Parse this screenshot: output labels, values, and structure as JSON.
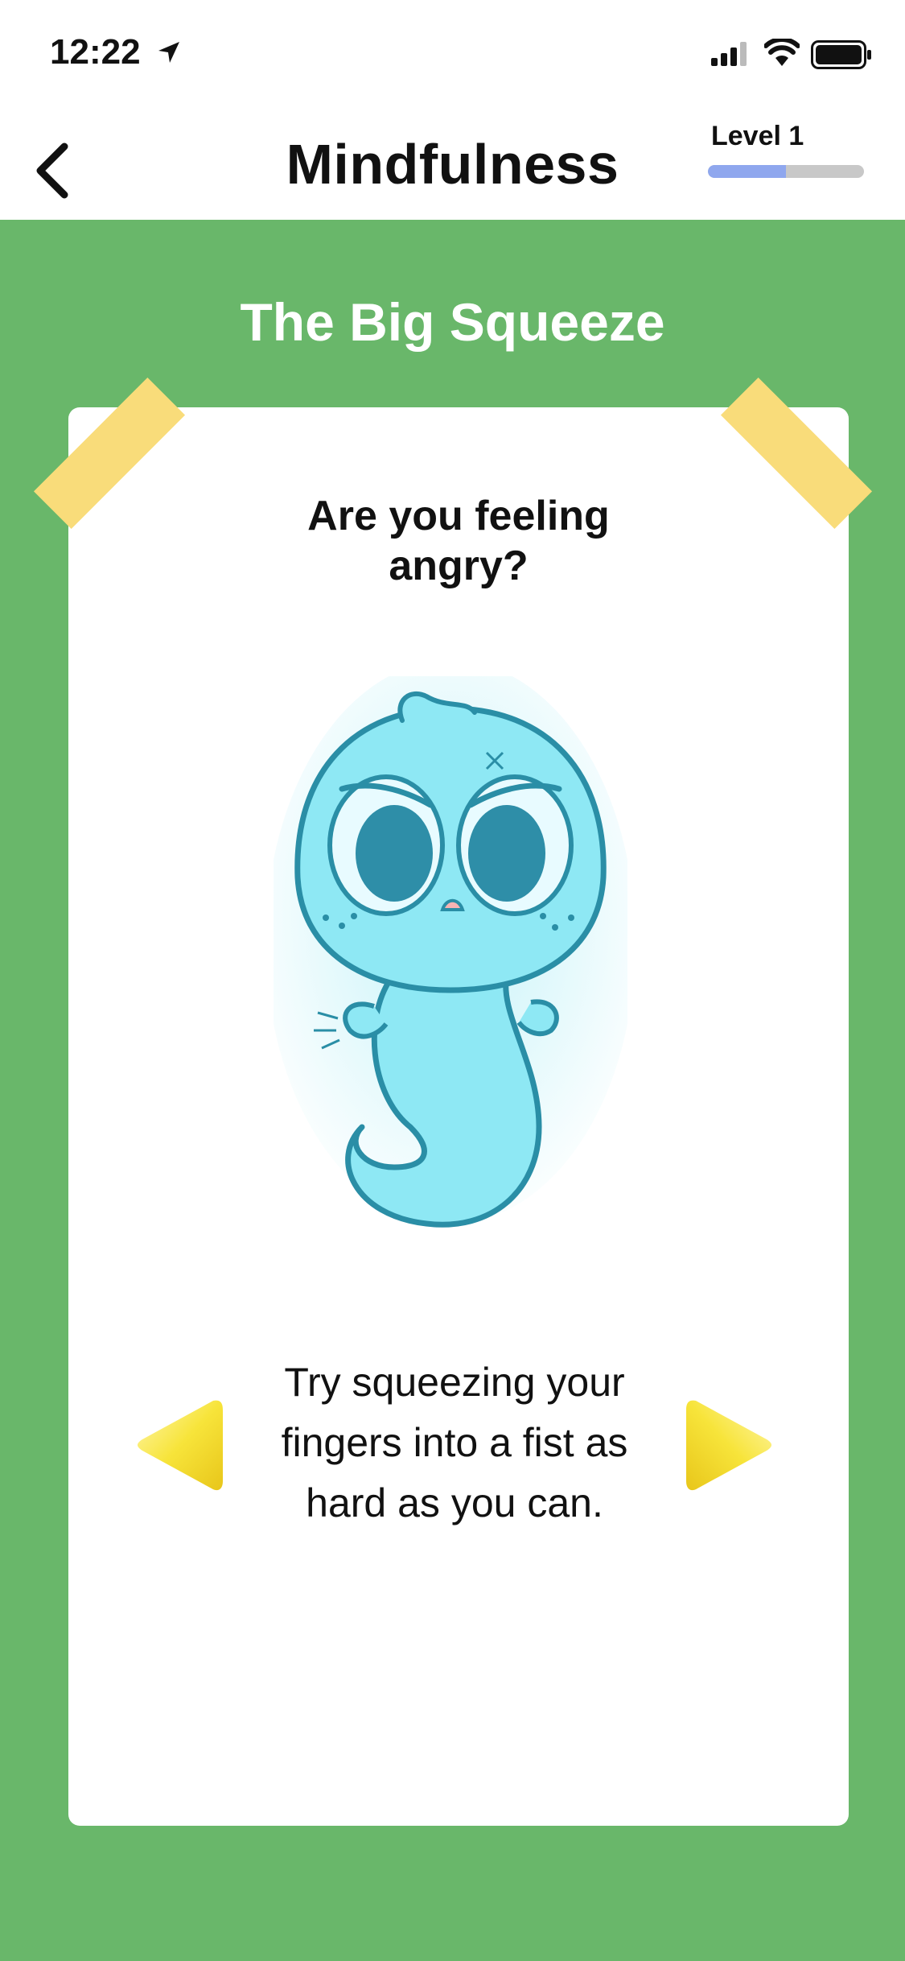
{
  "status_bar": {
    "time": "12:22",
    "icons": [
      "location-arrow-icon",
      "signal-icon",
      "wifi-icon",
      "battery-icon"
    ]
  },
  "nav": {
    "back_icon": "chevron-left-icon",
    "title": "Mindfulness",
    "level_label": "Level 1",
    "level_progress": 0.5
  },
  "activity": {
    "title": "The Big Squeeze",
    "question_lines": [
      "Are you feeling",
      "angry?"
    ],
    "instruction_lines": [
      "Try squeezing your",
      "fingers into a fist as",
      "hard as you can."
    ],
    "character": "angry-ghost-illustration",
    "prev_icon": "yellow-left-triangle-icon",
    "next_icon": "yellow-right-triangle-icon"
  },
  "colors": {
    "background": "#69b76a",
    "card": "#ffffff",
    "tape": "#f9dc7a",
    "progress_fill": "#8fa7ee",
    "progress_track": "#c8c8c8",
    "arrow": "#f6e02c",
    "ghost": "#7fe3f0"
  }
}
